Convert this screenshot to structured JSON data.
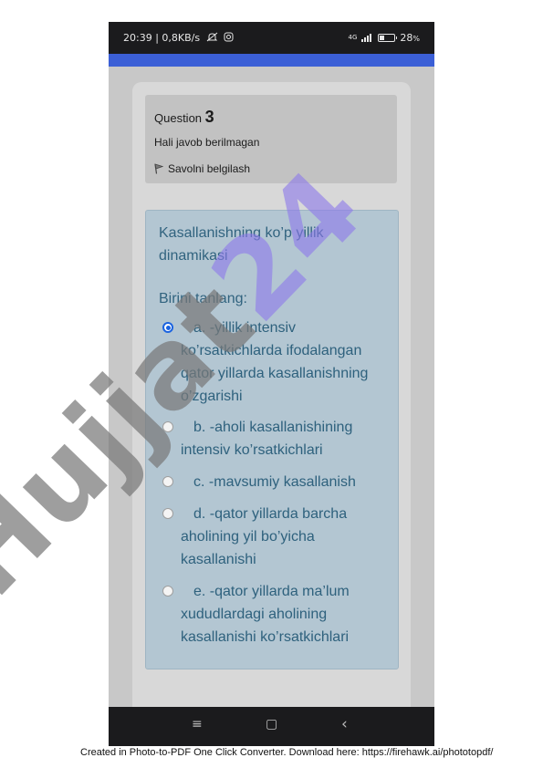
{
  "status_bar": {
    "left_text": "20:39 | 0,8KB/s",
    "network": "4G",
    "battery": "28",
    "battery_unit": "%",
    "battery_level": 0.28
  },
  "info": {
    "question_prefix": "Question",
    "question_number": "3",
    "status": "Hali javob berilmagan",
    "flag_label": "Savolni belgilash"
  },
  "question": {
    "text": "Kasallanishning ko’p yillik dinamikasi",
    "prompt": "Birini tanlang:",
    "options": [
      {
        "letter": "a.",
        "label": "-yillik intensiv ko’rsatkichlarda ifodalangan qator yillarda kasallanishning o’zgarishi",
        "selected": true
      },
      {
        "letter": "b.",
        "label": "-aholi kasallanishining intensiv ko’rsatkichlari",
        "selected": false
      },
      {
        "letter": "c.",
        "label": "-mavsumiy kasallanish",
        "selected": false
      },
      {
        "letter": "d.",
        "label": "-qator yillarda barcha aholining yil bo’yicha kasallanishi",
        "selected": false
      },
      {
        "letter": "e.",
        "label": "-qator yillarda ma’lum xududlardagi aholining kasallanishi ko’rsatkichlari",
        "selected": false
      }
    ]
  },
  "watermark": {
    "text": "Hujjat",
    "number": "24"
  },
  "footer": "Created in Photo-to-PDF One Click Converter. Download here: https://firehawk.ai/phototopdf/",
  "icons": {
    "nav_menu": "≡",
    "nav_home": "▢",
    "nav_back": "‹",
    "flag": "flag-icon",
    "silent": "no-alert-icon",
    "instagram": "instagram-icon"
  },
  "colors": {
    "accent": "#3b5fd6",
    "question_bg": "#b3c6d2",
    "question_text": "#31637f",
    "radio_selected": "#1a63e0"
  }
}
